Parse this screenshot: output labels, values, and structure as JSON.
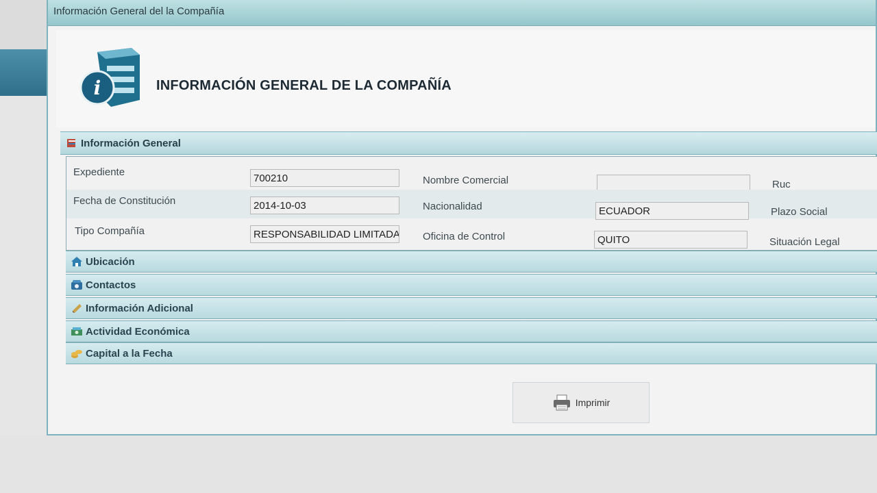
{
  "window": {
    "title": "Información General del la Compañía"
  },
  "header": {
    "title": "INFORMACIÓN GENERAL DE LA COMPAÑÍA",
    "icon": "info-cabinet-icon"
  },
  "section": {
    "title": "Información General",
    "icon": "info-icon"
  },
  "fields": {
    "expediente": {
      "label": "Expediente",
      "value": "700210"
    },
    "fecha": {
      "label": "Fecha de Constitución",
      "value": "2014-10-03"
    },
    "tipo": {
      "label": "Tipo Compañía",
      "value": "RESPONSABILIDAD LIMITADA"
    },
    "nombre_comercial": {
      "label": "Nombre Comercial",
      "value": ""
    },
    "nacionalidad": {
      "label": "Nacionalidad",
      "value": "ECUADOR"
    },
    "oficina": {
      "label": "Oficina de Control",
      "value": "QUITO"
    },
    "ruc": {
      "label": "Ruc"
    },
    "plazo": {
      "label": "Plazo Social"
    },
    "situacion": {
      "label": "Situación Legal"
    }
  },
  "accordion": [
    {
      "label": "Ubicación",
      "icon": "home-icon"
    },
    {
      "label": "Contactos",
      "icon": "phone-icon"
    },
    {
      "label": "Información Adicional",
      "icon": "pencil-icon"
    },
    {
      "label": "Actividad Económica",
      "icon": "money-icon"
    },
    {
      "label": "Capital a la Fecha",
      "icon": "coins-icon"
    }
  ],
  "print_button": {
    "label": "Imprimir",
    "icon": "printer-icon"
  },
  "colors": {
    "accent": "#95c7cc",
    "section": "#b3d7dd",
    "text": "#28404a"
  }
}
